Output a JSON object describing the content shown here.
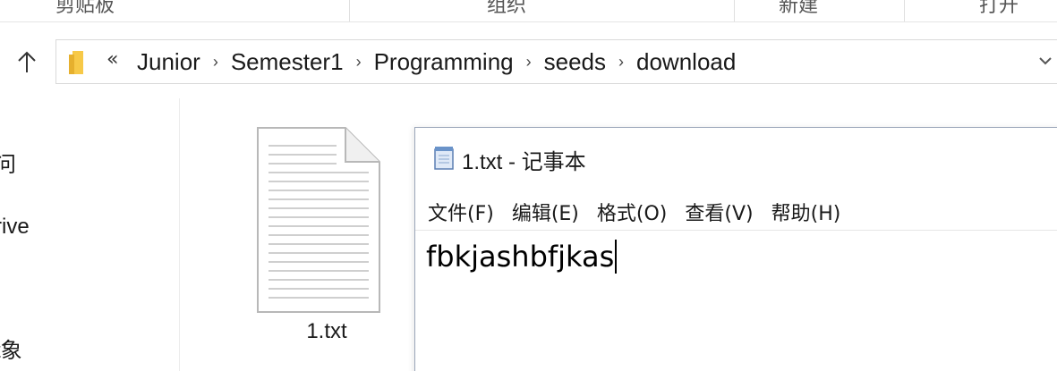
{
  "ribbon": {
    "groups": [
      "剪贴板",
      "组织",
      "新建",
      "打开"
    ]
  },
  "address_bar": {
    "overflow": "«",
    "crumbs": [
      "Junior",
      "Semester1",
      "Programming",
      "seeds",
      "download"
    ]
  },
  "nav_pane": {
    "items": [
      "问",
      "rive",
      "t象"
    ]
  },
  "files": [
    {
      "name": "1.txt",
      "icon": "text-file-icon"
    }
  ],
  "notepad": {
    "title": "1.txt - 记事本",
    "menu": [
      "文件(F)",
      "编辑(E)",
      "格式(O)",
      "查看(V)",
      "帮助(H)"
    ],
    "content": "fbkjashbfjkas"
  }
}
